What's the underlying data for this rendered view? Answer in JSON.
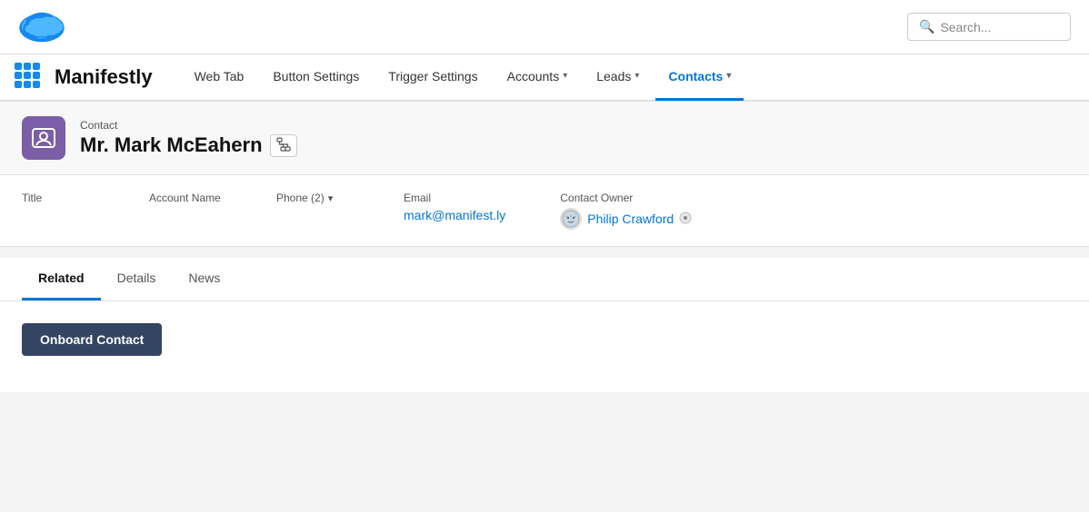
{
  "topbar": {
    "search_placeholder": "Search..."
  },
  "navbar": {
    "app_name": "Manifestly",
    "items": [
      {
        "label": "Web Tab",
        "active": false,
        "has_chevron": false
      },
      {
        "label": "Button Settings",
        "active": false,
        "has_chevron": false
      },
      {
        "label": "Trigger Settings",
        "active": false,
        "has_chevron": false
      },
      {
        "label": "Accounts",
        "active": false,
        "has_chevron": true
      },
      {
        "label": "Leads",
        "active": false,
        "has_chevron": true
      },
      {
        "label": "Contacts",
        "active": true,
        "has_chevron": true
      }
    ]
  },
  "contact": {
    "entity_label": "Contact",
    "name": "Mr. Mark McEahern",
    "title_label": "Title",
    "title_value": "",
    "account_name_label": "Account Name",
    "account_name_value": "",
    "phone_label": "Phone (2)",
    "phone_value": "",
    "email_label": "Email",
    "email_value": "mark@manifest.ly",
    "owner_label": "Contact Owner",
    "owner_name": "Philip Crawford"
  },
  "tabs": [
    {
      "label": "Related",
      "active": true
    },
    {
      "label": "Details",
      "active": false
    },
    {
      "label": "News",
      "active": false
    }
  ],
  "actions": {
    "onboard_label": "Onboard Contact"
  },
  "icons": {
    "search": "🔍",
    "contact": "👤",
    "hierarchy": "⠿",
    "chevron_down": "▾",
    "owner_edit": "✎",
    "grid": "grid"
  }
}
